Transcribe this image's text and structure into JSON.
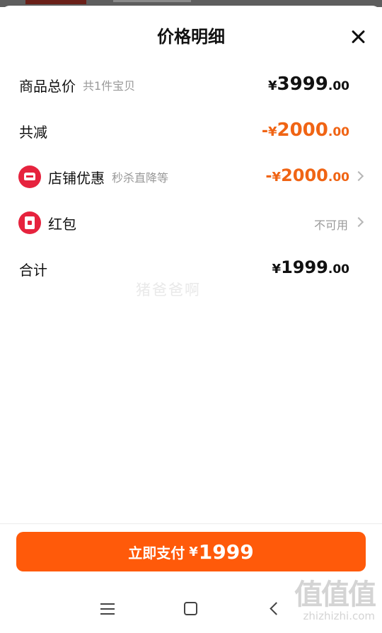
{
  "sheet": {
    "title": "价格明细"
  },
  "rows": [
    {
      "label": "商品总价",
      "sub": "共1件宝贝",
      "currency": "¥",
      "int": "3999",
      "dec": ".00",
      "prefix": ""
    },
    {
      "label": "共减",
      "sub": "",
      "currency": "¥",
      "int": "2000",
      "dec": ".00",
      "prefix": "-"
    },
    {
      "label": "店铺优惠",
      "sub": "秒杀直降等",
      "currency": "¥",
      "int": "2000",
      "dec": ".00",
      "prefix": "-"
    },
    {
      "label": "红包",
      "sub": "",
      "status": "不可用"
    },
    {
      "label": "合计",
      "sub": "",
      "currency": "¥",
      "int": "1999",
      "dec": ".00",
      "prefix": ""
    }
  ],
  "watermark": "猪爸爸啊",
  "pay": {
    "label": "立即支付",
    "currency": "¥",
    "amount": "1999"
  },
  "brand": {
    "glyphs": "值值值",
    "url": "zhizhizhi.com"
  },
  "colors": {
    "accent": "#ff5a0a",
    "discount": "#f06414",
    "icon_red": "#e6233e"
  },
  "icons": [
    "close-icon",
    "shop-icon",
    "red-envelope-icon",
    "chevron-right-icon",
    "menu-icon",
    "home-icon",
    "back-icon"
  ]
}
